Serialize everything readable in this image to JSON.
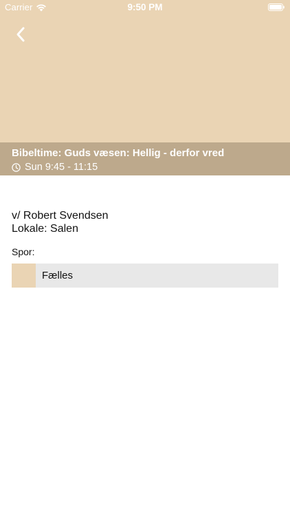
{
  "status_bar": {
    "carrier": "Carrier",
    "time": "9:50 PM",
    "wifi_icon": "wifi-icon",
    "battery_icon": "battery-icon"
  },
  "header": {
    "color": "#ead4b4",
    "back_icon": "chevron-left-icon"
  },
  "event": {
    "title": "Bibeltime: Guds væsen: Hellig - derfor vred",
    "time": "Sun 9:45 - 11:15",
    "title_bar_color": "#bda98c",
    "speaker": "v/ Robert Svendsen",
    "room": "Lokale: Salen"
  },
  "tracks": {
    "label": "Spor:",
    "items": [
      {
        "name": "Fælles",
        "color": "#ead4b4"
      }
    ]
  }
}
